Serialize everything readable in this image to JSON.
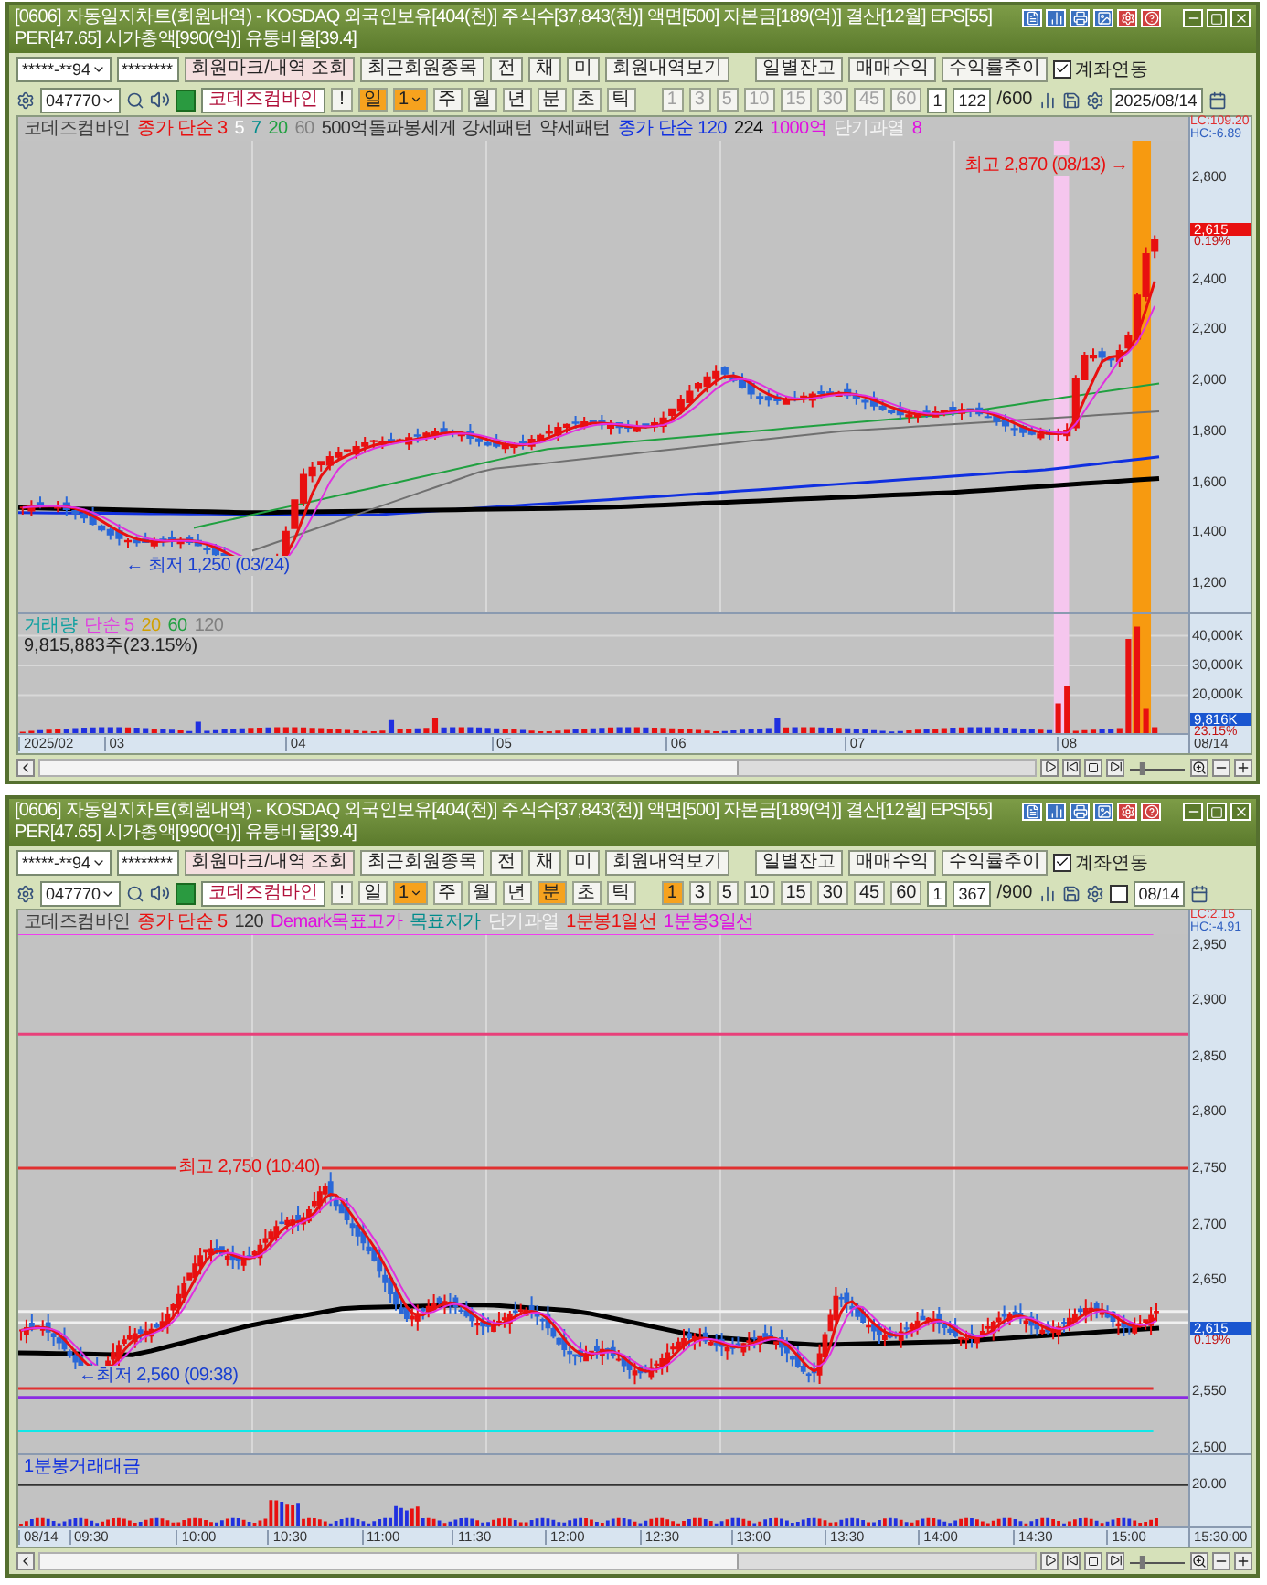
{
  "windows": [
    {
      "title": "[0606] 자동일지차트(회원내역) - KOSDAQ 외국인보유[404(천)] 주식수[37,843(천)] 액면[500] 자본금[189(억)] 결산[12월] EPS[55] PER[47.65] 시가총액[990(억)] 유통비율[39.4]",
      "account": "*****-**94",
      "password": "********",
      "member_buttons": [
        "회원마크/내역 조회",
        "최근회원종목",
        "전",
        "채",
        "미",
        "회원내역보기"
      ],
      "report_buttons": [
        "일별잔고",
        "매매수익",
        "수익률추이"
      ],
      "link": {
        "label": "계좌연동",
        "checked": true
      },
      "code": "047770",
      "name": "코데즈컴바인",
      "alert": "!",
      "period_count": "1",
      "periods": [
        {
          "label": "일",
          "selected": true
        },
        {
          "label": "주",
          "selected": false
        },
        {
          "label": "월",
          "selected": false
        },
        {
          "label": "년",
          "selected": false
        },
        {
          "label": "분",
          "selected": false
        },
        {
          "label": "초",
          "selected": false
        },
        {
          "label": "틱",
          "selected": false
        }
      ],
      "intervals_disabled": true,
      "intervals": [
        {
          "label": "1",
          "selected": false
        },
        {
          "label": "3",
          "selected": false
        },
        {
          "label": "5",
          "selected": false
        },
        {
          "label": "10",
          "selected": false
        },
        {
          "label": "15",
          "selected": false
        },
        {
          "label": "30",
          "selected": false
        },
        {
          "label": "45",
          "selected": false
        },
        {
          "label": "60",
          "selected": false
        }
      ],
      "count": "1",
      "bars": "122",
      "max": "/600",
      "date": "2025/08/14",
      "legend": [
        {
          "text": "코데즈컴바인",
          "color": "#404040"
        },
        {
          "text": "종가 단순 3",
          "color": "#e81010"
        },
        {
          "text": "5",
          "color": "#ffffff"
        },
        {
          "text": "7",
          "color": "#008c8c"
        },
        {
          "text": "20",
          "color": "#20a040"
        },
        {
          "text": "60",
          "color": "#808080"
        },
        {
          "text": "500억돌파봉세게 강세패턴",
          "color": "#303030"
        },
        {
          "text": "약세패턴",
          "color": "#303030"
        },
        {
          "text": "종가 단순 120",
          "color": "#1030e0"
        },
        {
          "text": "224",
          "color": "#101010"
        },
        {
          "text": "1000억",
          "color": "#e010e0"
        },
        {
          "text": "단기과열",
          "color": "#f4f4f4"
        },
        {
          "text": "8",
          "color": "#e010e0"
        }
      ],
      "lc": "LC:109.20",
      "hc": "HC:-6.89",
      "yticks": [
        "2,800",
        "2,400",
        "2,200",
        "2,000",
        "1,800",
        "1,600",
        "1,400",
        "1,200"
      ],
      "badge": {
        "price": "2,615",
        "change": "0.19%",
        "color": "#e81010"
      },
      "annotations": [
        {
          "kind": "high",
          "text": "최고 2,870 (08/13) →"
        },
        {
          "kind": "low",
          "text": "← 최저 1,250 (03/24)"
        }
      ],
      "volume": {
        "legend": [
          {
            "text": "거래량",
            "color": "#10a0a0"
          },
          {
            "text": "단순 5",
            "color": "#e040e0"
          },
          {
            "text": "20",
            "color": "#d0a000"
          },
          {
            "text": "60",
            "color": "#20a040"
          },
          {
            "text": "120",
            "color": "#808080"
          }
        ],
        "info": "9,815,883주(23.15%)",
        "yticks": [
          "40,000K",
          "30,000K",
          "20,000K"
        ],
        "badge": {
          "value": "9,816K",
          "share": "23.15%"
        }
      },
      "xticks": [
        "2025/02",
        "03",
        "04",
        "05",
        "06",
        "07",
        "08"
      ],
      "xlast": "08/14",
      "zoom_slider": {
        "level": 0.2
      }
    },
    {
      "title": "[0606] 자동일지차트(회원내역) - KOSDAQ 외국인보유[404(천)] 주식수[37,843(천)] 액면[500] 자본금[189(억)] 결산[12월] EPS[55] PER[47.65] 시가총액[990(억)] 유통비율[39.4]",
      "account": "*****-**94",
      "password": "********",
      "member_buttons": [
        "회원마크/내역 조회",
        "최근회원종목",
        "전",
        "채",
        "미",
        "회원내역보기"
      ],
      "report_buttons": [
        "일별잔고",
        "매매수익",
        "수익률추이"
      ],
      "link": {
        "label": "계좌연동",
        "checked": true
      },
      "code": "047770",
      "name": "코데즈컴바인",
      "alert": "!",
      "period_count": "1",
      "periods": [
        {
          "label": "일",
          "selected": false
        },
        {
          "label": "주",
          "selected": false
        },
        {
          "label": "월",
          "selected": false
        },
        {
          "label": "년",
          "selected": false
        },
        {
          "label": "분",
          "selected": true
        },
        {
          "label": "초",
          "selected": false
        },
        {
          "label": "틱",
          "selected": false
        }
      ],
      "intervals_disabled": false,
      "intervals": [
        {
          "label": "1",
          "selected": true
        },
        {
          "label": "3",
          "selected": false
        },
        {
          "label": "5",
          "selected": false
        },
        {
          "label": "10",
          "selected": false
        },
        {
          "label": "15",
          "selected": false
        },
        {
          "label": "30",
          "selected": false
        },
        {
          "label": "45",
          "selected": false
        },
        {
          "label": "60",
          "selected": false
        }
      ],
      "count": "1",
      "bars": "367",
      "max": "/900",
      "date_checkbox": {
        "checked": false
      },
      "date": "08/14",
      "legend": [
        {
          "text": "코데즈컴바인",
          "color": "#404040"
        },
        {
          "text": "종가 단순 5",
          "color": "#e81010"
        },
        {
          "text": "120",
          "color": "#303030"
        },
        {
          "text": "Demark목표고가",
          "color": "#e010e0"
        },
        {
          "text": "목표저가",
          "color": "#008c8c"
        },
        {
          "text": "단기과열",
          "color": "#f4f4f4"
        },
        {
          "text": "1분봉1일선",
          "color": "#e81010"
        },
        {
          "text": "1분봉3일선",
          "color": "#e010e0"
        }
      ],
      "lc": "LC:2.15",
      "hc": "HC:-4.91",
      "yticks": [
        "2,950",
        "2,900",
        "2,850",
        "2,800",
        "2,750",
        "2,700",
        "2,650",
        "2,550",
        "2,500"
      ],
      "badge": {
        "price": "2,615",
        "change": "0.19%",
        "color": "#1a56d0"
      },
      "annotations": [
        {
          "kind": "high",
          "text": "최고 2,750 (10:40)"
        },
        {
          "kind": "low",
          "text": "←최저 2,560 (09:38)"
        }
      ],
      "volume": {
        "legend": [
          {
            "text": "1분봉거래대금",
            "color": "#1030e0"
          }
        ],
        "yticks": [
          "20.00"
        ]
      },
      "xticks": [
        "08/14",
        "09:30",
        "10:00",
        "10:30",
        "11:00",
        "11:30",
        "12:00",
        "12:30",
        "13:00",
        "13:30",
        "14:00",
        "14:30",
        "15:00"
      ],
      "xlast": "15:30:00",
      "zoom_slider": {
        "level": 0.2
      }
    }
  ]
}
